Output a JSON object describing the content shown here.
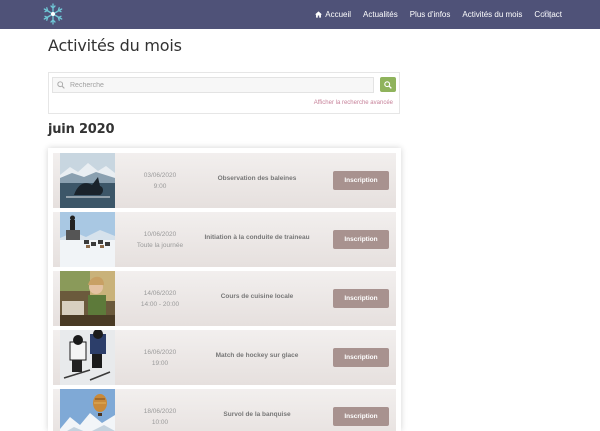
{
  "nav": {
    "items": [
      {
        "label": "Accueil",
        "icon": "home-icon"
      },
      {
        "label": "Actualités"
      },
      {
        "label": "Plus d'infos"
      },
      {
        "label": "Activités du mois"
      },
      {
        "label": "Contact"
      }
    ],
    "search_icon": "search-icon",
    "logo": "snowflake-logo"
  },
  "page": {
    "title": "Activités du mois"
  },
  "search": {
    "placeholder": "Recherche",
    "advanced_link": "Afficher la recherche avancée"
  },
  "month": {
    "heading": "juin 2020"
  },
  "events": [
    {
      "date": "03/06/2020",
      "time": "9:00",
      "title": "Observation des baleines",
      "button": "Inscription",
      "image": "whale"
    },
    {
      "date": "10/06/2020",
      "time": "Toute la journée",
      "title": "Initiation à la conduite de traineau",
      "button": "Inscription",
      "image": "dog-sled"
    },
    {
      "date": "14/06/2020",
      "time": "14:00 - 20:00",
      "title": "Cours de cuisine locale",
      "button": "Inscription",
      "image": "cooking"
    },
    {
      "date": "16/06/2020",
      "time": "19:00",
      "title": "Match de hockey sur glace",
      "button": "Inscription",
      "image": "hockey"
    },
    {
      "date": "18/06/2020",
      "time": "10:00",
      "title": "Survol de la banquise",
      "button": "Inscription",
      "image": "balloon"
    }
  ],
  "colors": {
    "topbar": "#4f5278",
    "button": "#a8928f",
    "search_button": "#8fb35c",
    "link": "#c7829a"
  }
}
